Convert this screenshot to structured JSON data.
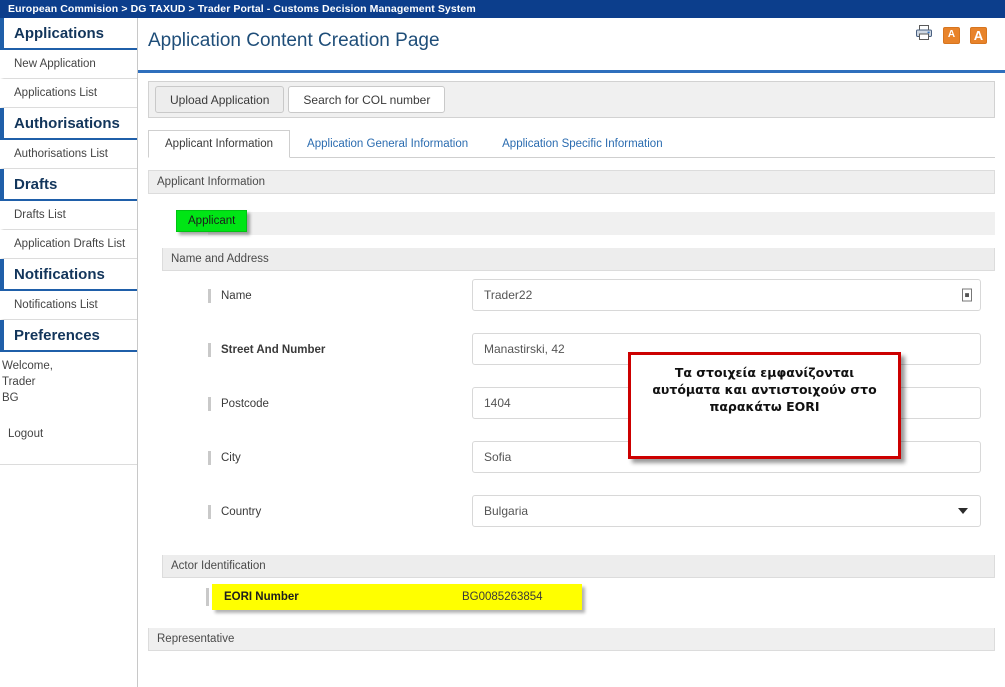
{
  "topbar": {
    "breadcrumb": "European Commision > DG TAXUD > Trader Portal - Customs Decision Management System"
  },
  "sidebar": {
    "sections": [
      {
        "heading": "Applications",
        "items": [
          "New Application",
          "Applications List"
        ]
      },
      {
        "heading": "Authorisations",
        "items": [
          "Authorisations List"
        ]
      },
      {
        "heading": "Drafts",
        "items": [
          "Drafts List",
          "Application Drafts List"
        ]
      },
      {
        "heading": "Notifications",
        "items": [
          "Notifications List"
        ]
      },
      {
        "heading": "Preferences",
        "items": []
      }
    ],
    "welcome_line1": "Welcome,",
    "welcome_line2": "Trader",
    "welcome_line3": "BG",
    "logout": "Logout"
  },
  "header": {
    "title": "Application Content Creation Page",
    "icons": [
      "print-icon",
      "font-decrease-icon",
      "font-increase-icon"
    ],
    "font_icon_letter": "A"
  },
  "toolbar": {
    "upload_label": "Upload Application",
    "search_col_label": "Search for COL number"
  },
  "tabs": [
    {
      "label": "Applicant Information",
      "active": true
    },
    {
      "label": "Application General Information",
      "active": false
    },
    {
      "label": "Application Specific Information",
      "active": false
    }
  ],
  "sections": {
    "applicant_information": "Applicant Information",
    "applicant_badge": "Applicant",
    "name_and_address": "Name and Address",
    "actor_identification": "Actor Identification",
    "representative": "Representative"
  },
  "form": {
    "fields": [
      {
        "label": "Name",
        "value": "Trader22",
        "bold": false,
        "control": "text-with-id-icon"
      },
      {
        "label": "Street And Number",
        "value": "Manastirski, 42",
        "bold": true,
        "control": "text"
      },
      {
        "label": "Postcode",
        "value": "1404",
        "bold": false,
        "control": "text"
      },
      {
        "label": "City",
        "value": "Sofia",
        "bold": false,
        "control": "text"
      },
      {
        "label": "Country",
        "value": "Bulgaria",
        "bold": false,
        "control": "select"
      }
    ]
  },
  "eori": {
    "label": "EORI Number",
    "value": "BG0085263854",
    "highlight_color": "#ffff00"
  },
  "callout": {
    "text": "Τα στοιχεία εμφανίζονται αυτόματα και αντιστοιχούν στο παρακάτω EORI",
    "border_color": "#cc0000"
  },
  "colors": {
    "topbar_blue": "#0c3e8c",
    "accent_blue": "#1f5fa9",
    "title_blue": "#1f4e79",
    "badge_green": "#00e515",
    "icon_orange": "#e8832a"
  }
}
